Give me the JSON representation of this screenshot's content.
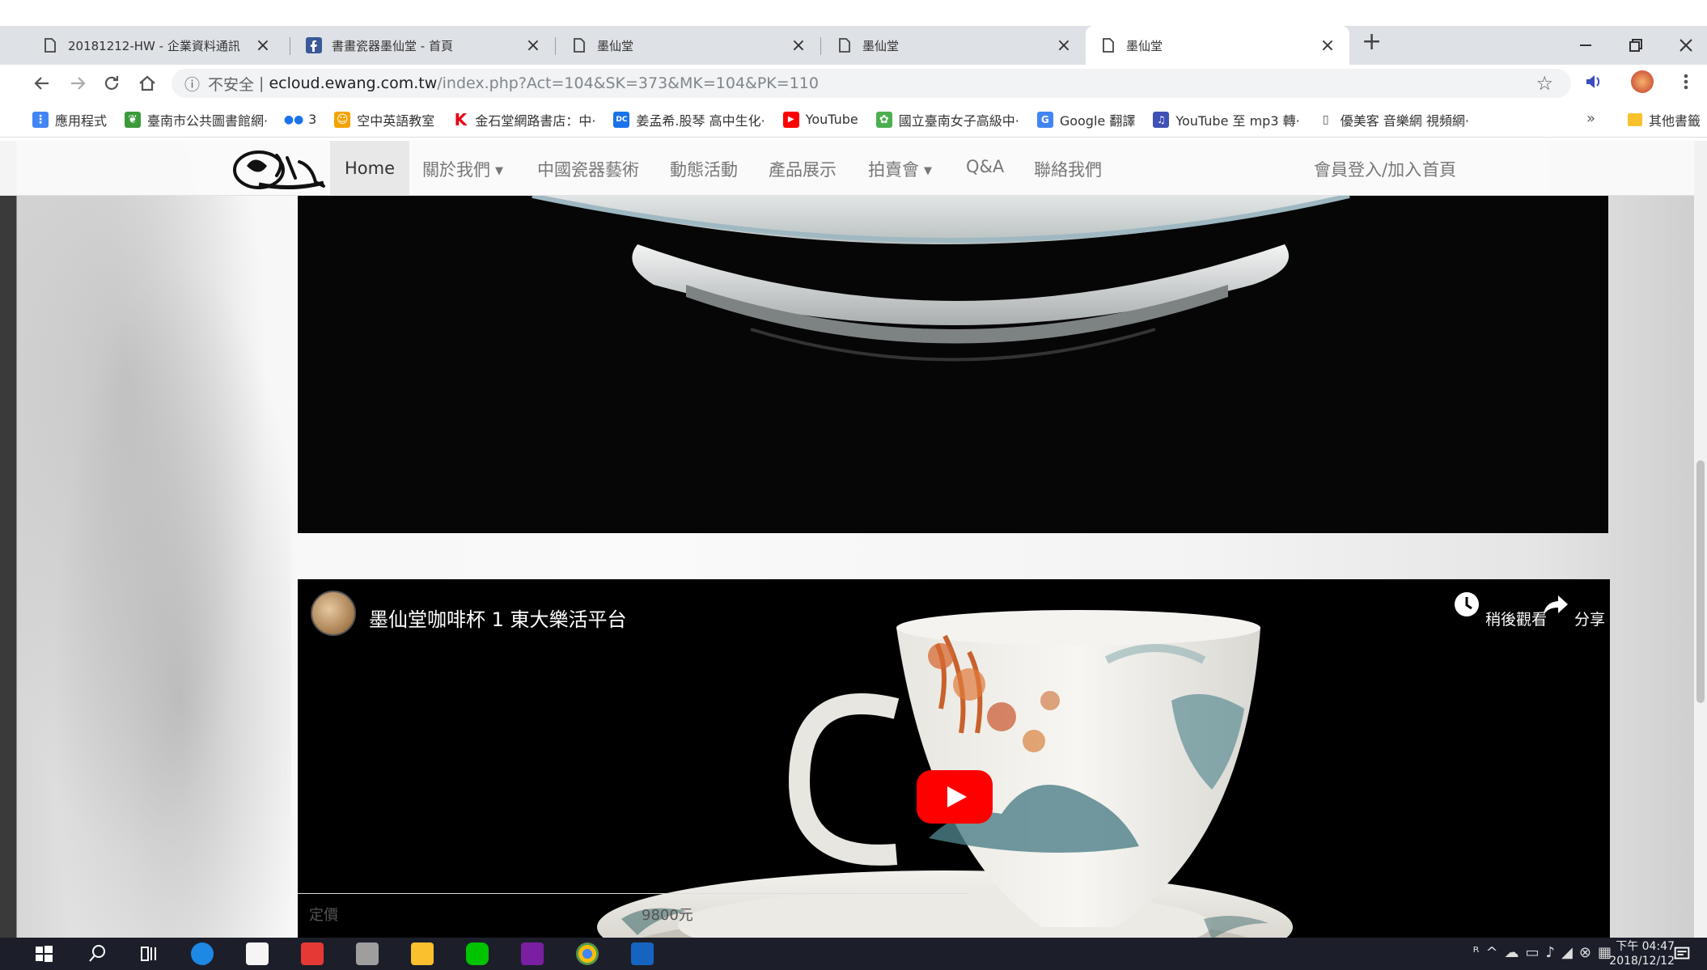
{
  "browser": {
    "tabs": [
      {
        "title": "20181212-HW - 企業資料通訊",
        "active": false,
        "favicon": "page-icon"
      },
      {
        "title": "書畫瓷器墨仙堂 - 首頁",
        "active": false,
        "favicon": "facebook-icon"
      },
      {
        "title": "墨仙堂",
        "active": false,
        "favicon": "page-icon"
      },
      {
        "title": "墨仙堂",
        "active": false,
        "favicon": "page-icon"
      },
      {
        "title": "墨仙堂",
        "active": true,
        "favicon": "page-icon"
      }
    ],
    "close_glyph": "×",
    "new_tab_glyph": "+",
    "address": {
      "security_label": "不安全",
      "host": "ecloud.ewang.com.tw",
      "path": "/index.php?Act=104&SK=373&MK=104&PK=110"
    },
    "bookmarks": [
      {
        "label": "應用程式",
        "icon": "apps-grid-icon",
        "color": "#4285f4"
      },
      {
        "label": "臺南市公共圖書館網·",
        "icon": "library-icon",
        "color": "#3c9a3c"
      },
      {
        "label": "3",
        "icon": "dots-icon",
        "color": "#1a73e8"
      },
      {
        "label": "空中英語教室",
        "icon": "cartoon-icon",
        "color": "#f4a300"
      },
      {
        "label": "金石堂網路書店：中·",
        "icon": "k-logo-icon",
        "color": "#e60012"
      },
      {
        "label": "姜孟希.股琴 高中生化·",
        "icon": "dcard-icon",
        "color": "#1a73e8"
      },
      {
        "label": "YouTube",
        "icon": "youtube-icon",
        "color": "#ff0000"
      },
      {
        "label": "國立臺南女子高級中·",
        "icon": "school-icon",
        "color": "#4caf50"
      },
      {
        "label": "Google 翻譯",
        "icon": "translate-icon",
        "color": "#4285f4"
      },
      {
        "label": "YouTube 至 mp3 轉·",
        "icon": "mp3-icon",
        "color": "#3f51b5"
      },
      {
        "label": "優美客 音樂網 視頻網·",
        "icon": "page-icon",
        "color": "#888888"
      }
    ],
    "bookmarks_more": "»",
    "other_bookmarks": "其他書籤"
  },
  "site": {
    "logo_alt": "墨仙堂",
    "nav": [
      {
        "label": "Home",
        "active": true,
        "dropdown": false
      },
      {
        "label": "關於我們",
        "active": false,
        "dropdown": true
      },
      {
        "label": "中國瓷器藝術",
        "active": false,
        "dropdown": false
      },
      {
        "label": "動態活動",
        "active": false,
        "dropdown": false
      },
      {
        "label": "產品展示",
        "active": false,
        "dropdown": false
      },
      {
        "label": "拍賣會",
        "active": false,
        "dropdown": true
      },
      {
        "label": "Q&A",
        "active": false,
        "dropdown": false
      },
      {
        "label": "聯絡我們",
        "active": false,
        "dropdown": false
      }
    ],
    "nav_right": [
      {
        "label": "會員登入/加入"
      },
      {
        "label": "首頁"
      }
    ],
    "video": {
      "title": "墨仙堂咖啡杯 1 東大樂活平台",
      "watch_later": "稍後觀看",
      "share": "分享"
    },
    "price": {
      "label": "定價",
      "value": "9800元"
    }
  },
  "taskbar": {
    "clock_period_time": "下午 04:47",
    "clock_date": "2018/12/12"
  },
  "colors": {
    "youtube_red": "#ff0000",
    "page_bg": "#f5f5f5",
    "taskbar": "#1c1f2a"
  }
}
